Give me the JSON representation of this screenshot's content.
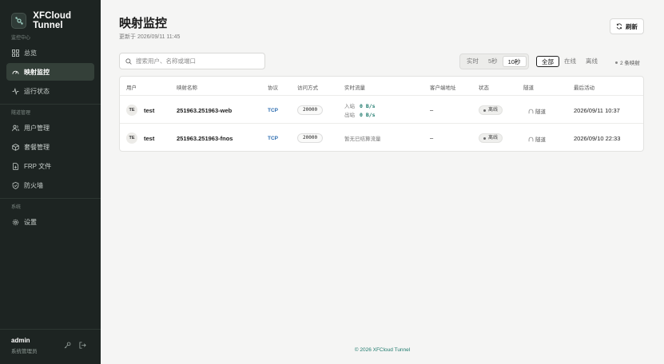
{
  "sidebar": {
    "brand": "XFCloud Tunnel",
    "sections": [
      {
        "title": "监控中心",
        "items": [
          {
            "label": "总览",
            "icon": "grid-icon"
          },
          {
            "label": "映射监控",
            "icon": "gauge-icon",
            "active": true
          },
          {
            "label": "运行状态",
            "icon": "activity-icon"
          }
        ]
      },
      {
        "title": "隧道管理",
        "items": [
          {
            "label": "用户管理",
            "icon": "users-icon"
          },
          {
            "label": "套餐管理",
            "icon": "package-icon"
          },
          {
            "label": "FRP 文件",
            "icon": "file-icon"
          },
          {
            "label": "防火墙",
            "icon": "shield-icon"
          }
        ]
      },
      {
        "title": "系统",
        "items": [
          {
            "label": "设置",
            "icon": "gear-icon"
          }
        ]
      }
    ],
    "user": {
      "name": "admin",
      "role": "系统管理员"
    }
  },
  "header": {
    "title": "映射监控",
    "updated": "更新于 2026/09/11 11:45",
    "refresh_label": "刷新"
  },
  "toolbar": {
    "search_placeholder": "搜索用户、名称或端口",
    "rate_options": [
      "实时",
      "5秒",
      "10秒"
    ],
    "rate_selected": "10秒",
    "filter_options": [
      "全部",
      "在线",
      "离线"
    ],
    "filter_selected": "全部",
    "mapping_count": "2 条映射"
  },
  "table": {
    "columns": [
      "用户",
      "映射名称",
      "协议",
      "访问方式",
      "实时流量",
      "客户端地址",
      "状态",
      "隧道",
      "最后活动"
    ],
    "rows": [
      {
        "avatar": "TE",
        "user": "test",
        "name": "251963.251963-web",
        "protocol": "TCP",
        "port": "20000",
        "traffic_in_label": "入站",
        "traffic_in": "0 B/s",
        "traffic_out_label": "出站",
        "traffic_out": "0 B/s",
        "client": "–",
        "status": "离线",
        "tunnel": "隧道",
        "last_active": "2026/09/11 10:37"
      },
      {
        "avatar": "TE",
        "user": "test",
        "name": "251963.251963-fnos",
        "protocol": "TCP",
        "port": "20000",
        "traffic_note": "暂无已结算流量",
        "client": "–",
        "status": "离线",
        "tunnel": "隧道",
        "last_active": "2026/09/10 22:33"
      }
    ]
  },
  "footer": {
    "copyright": "© 2026 XFCloud Tunnel"
  },
  "colors": {
    "sidebar_bg": "#1d2422",
    "accent": "#1f7a6d",
    "protocol": "#2b6cb0"
  }
}
